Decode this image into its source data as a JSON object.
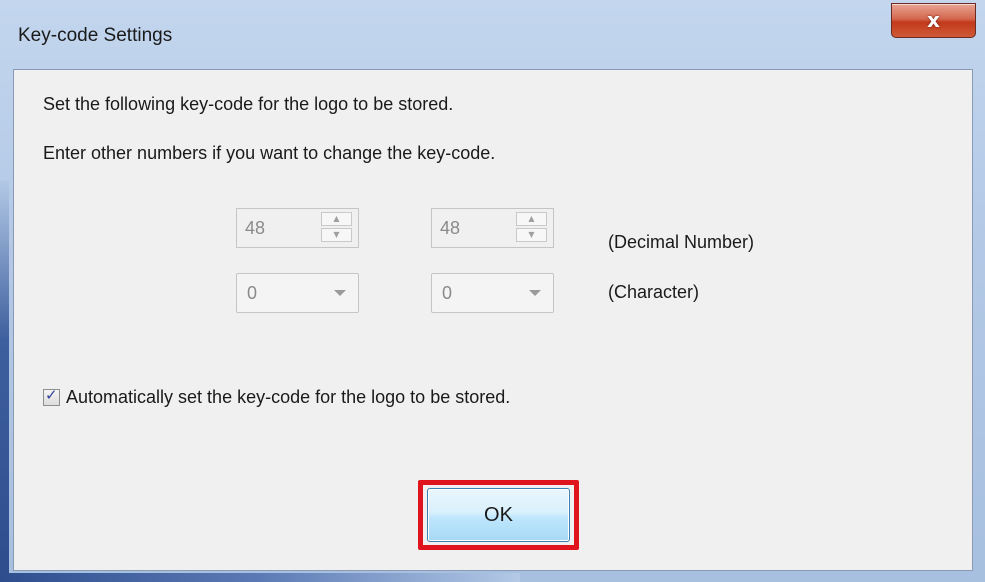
{
  "window": {
    "title": "Key-code Settings",
    "close_glyph": "x"
  },
  "instructions": {
    "line1": "Set the following key-code for the logo to be stored.",
    "line2": "Enter other numbers if you want to change the key-code."
  },
  "decimal_row": {
    "value1": "48",
    "value2": "48",
    "label": "(Decimal Number)"
  },
  "character_row": {
    "value1": "0",
    "value2": "0",
    "label": "(Character)"
  },
  "auto_checkbox": {
    "checked": true,
    "label": "Automatically set the key-code for the logo to be stored."
  },
  "buttons": {
    "ok_label": "OK"
  },
  "colors": {
    "highlight": "#e0141c",
    "close_button": "#c2391b"
  }
}
